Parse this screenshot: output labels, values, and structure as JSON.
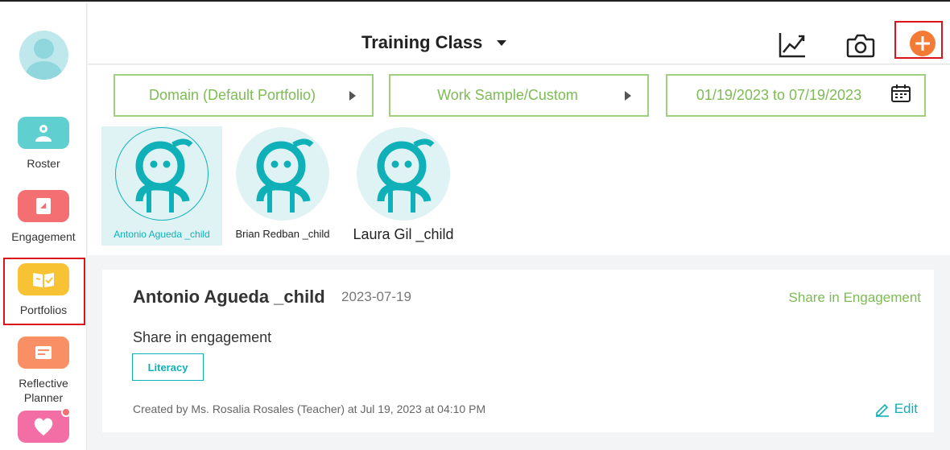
{
  "colors": {
    "accent_teal": "#0fb0b8",
    "accent_green": "#7dbb55",
    "add_orange": "#f47b36",
    "highlight_red": "#d9141b"
  },
  "sidebar": {
    "avatar_icon": "user-avatar-icon",
    "items": [
      {
        "label": "Roster",
        "icon": "roster-icon"
      },
      {
        "label": "Engagement",
        "icon": "engagement-icon"
      },
      {
        "label": "Portfolios",
        "icon": "portfolio-book-icon",
        "selected": true
      },
      {
        "label": "Reflective Planner",
        "icon": "planner-icon"
      },
      {
        "label": "",
        "icon": "heart-icon",
        "has_notification": true
      }
    ]
  },
  "header": {
    "title": "Training Class",
    "icons": [
      "chart-icon",
      "camera-icon",
      "add-icon"
    ]
  },
  "filters": {
    "domain": "Domain (Default Portfolio)",
    "work": "Work Sample/Custom",
    "date_range": "01/19/2023 to 07/19/2023"
  },
  "children": [
    {
      "name": "Antonio Agueda _child",
      "selected": true
    },
    {
      "name": "Brian Redban _child",
      "selected": false
    },
    {
      "name": "Laura Gil _child",
      "selected": false
    }
  ],
  "card": {
    "child_name": "Antonio Agueda _child",
    "date": "2023-07-19",
    "share_link": "Share in Engagement",
    "description": "Share in engagement",
    "tag": "Literacy",
    "meta": "Created by Ms. Rosalia Rosales (Teacher) at Jul 19, 2023 at 04:10 PM",
    "edit_label": "Edit"
  }
}
